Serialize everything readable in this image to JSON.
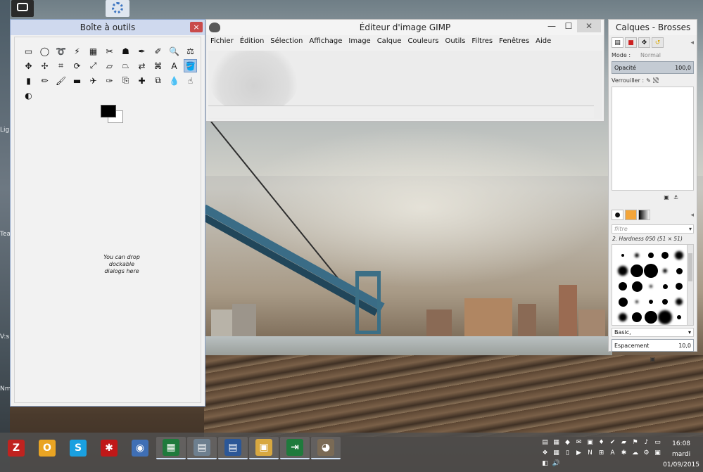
{
  "desktop": {
    "labels": [
      "Ligh",
      "Tea",
      "V:s",
      "Nm"
    ],
    "top_icons": [
      "camera-icon",
      "gimp-icon"
    ]
  },
  "toolbox": {
    "title": "Boîte à outils",
    "close_symbol": "×",
    "tools": [
      {
        "icon": "rect-select-icon",
        "glyph": "▭"
      },
      {
        "icon": "ellipse-select-icon",
        "glyph": "◯"
      },
      {
        "icon": "lasso-icon",
        "glyph": "➰"
      },
      {
        "icon": "fuzzy-select-icon",
        "glyph": "⚡"
      },
      {
        "icon": "color-select-icon",
        "glyph": "▦"
      },
      {
        "icon": "scissors-icon",
        "glyph": "✂"
      },
      {
        "icon": "foreground-select-icon",
        "glyph": "☗"
      },
      {
        "icon": "paths-icon",
        "glyph": "✒"
      },
      {
        "icon": "color-picker-icon",
        "glyph": "✐"
      },
      {
        "icon": "zoom-icon",
        "glyph": "🔍"
      },
      {
        "icon": "measure-icon",
        "glyph": "⚖"
      },
      {
        "icon": "move-icon",
        "glyph": "✥"
      },
      {
        "icon": "align-icon",
        "glyph": "✢"
      },
      {
        "icon": "crop-icon",
        "glyph": "⌗"
      },
      {
        "icon": "rotate-icon",
        "glyph": "⟳"
      },
      {
        "icon": "scale-icon",
        "glyph": "⤢"
      },
      {
        "icon": "shear-icon",
        "glyph": "▱"
      },
      {
        "icon": "perspective-icon",
        "glyph": "⏢"
      },
      {
        "icon": "flip-icon",
        "glyph": "⇄"
      },
      {
        "icon": "cage-icon",
        "glyph": "⌘"
      },
      {
        "icon": "text-icon",
        "glyph": "A"
      },
      {
        "icon": "bucket-fill-icon",
        "glyph": "🪣"
      },
      {
        "icon": "blend-icon",
        "glyph": "▮"
      },
      {
        "icon": "pencil-icon",
        "glyph": "✏"
      },
      {
        "icon": "paintbrush-icon",
        "glyph": "🖌"
      },
      {
        "icon": "eraser-icon",
        "glyph": "▬"
      },
      {
        "icon": "airbrush-icon",
        "glyph": "✈"
      },
      {
        "icon": "ink-icon",
        "glyph": "✑"
      },
      {
        "icon": "clone-icon",
        "glyph": "⎘"
      },
      {
        "icon": "heal-icon",
        "glyph": "✚"
      },
      {
        "icon": "perspective-clone-icon",
        "glyph": "⧉"
      },
      {
        "icon": "blur-icon",
        "glyph": "💧"
      },
      {
        "icon": "smudge-icon",
        "glyph": "☝"
      },
      {
        "icon": "dodge-burn-icon",
        "glyph": "◐"
      }
    ],
    "active_tool_index": 21,
    "fg_color": "#000000",
    "bg_color": "#ffffff",
    "drop_hint": "You can drop dockable dialogs here"
  },
  "gimp": {
    "title": "Éditeur d'image GIMP",
    "controls": {
      "minimize": "—",
      "maximize": "☐",
      "close": "✕"
    },
    "menu": [
      "Fichier",
      "Édition",
      "Sélection",
      "Affichage",
      "Image",
      "Calque",
      "Couleurs",
      "Outils",
      "Filtres",
      "Fenêtres",
      "Aide"
    ]
  },
  "layers": {
    "title": "Calques - Brosses",
    "mode_label": "Mode :",
    "mode_value": "Normal",
    "opacity_label": "Opacité",
    "opacity_value": "100,0",
    "lock_label": "Verrouiller :",
    "filter_placeholder": "filtre",
    "brush_name": "2. Hardness 050 (51 × 51)",
    "brush_set": "Basic,",
    "spacing_label": "Espacement",
    "spacing_value": "10,0"
  },
  "taskbar": {
    "apps": [
      {
        "icon": "filezilla-icon",
        "glyph": "Z",
        "color": "#c0231f"
      },
      {
        "icon": "outlook-icon",
        "glyph": "O",
        "color": "#e9a423"
      },
      {
        "icon": "skype-icon",
        "glyph": "S",
        "color": "#1aa0e0"
      },
      {
        "icon": "puzzle-icon",
        "glyph": "✱",
        "color": "#c01818"
      },
      {
        "icon": "thunderbird-icon",
        "glyph": "◉",
        "color": "#3f6fb5"
      },
      {
        "icon": "spreadsheet-icon",
        "glyph": "▦",
        "color": "#1f7a3c"
      },
      {
        "icon": "archive-icon",
        "glyph": "▤",
        "color": "#6d7f8f"
      },
      {
        "icon": "document-icon",
        "glyph": "▤",
        "color": "#2b5797"
      },
      {
        "icon": "photo-viewer-icon",
        "glyph": "▣",
        "color": "#d8a840"
      },
      {
        "icon": "exit-icon",
        "glyph": "⇥",
        "color": "#1f7a3c"
      },
      {
        "icon": "gimp-taskbar-icon",
        "glyph": "◕",
        "color": "#7a6a55"
      }
    ],
    "time": "16:08",
    "day": "mardi",
    "date": "01/09/2015"
  }
}
